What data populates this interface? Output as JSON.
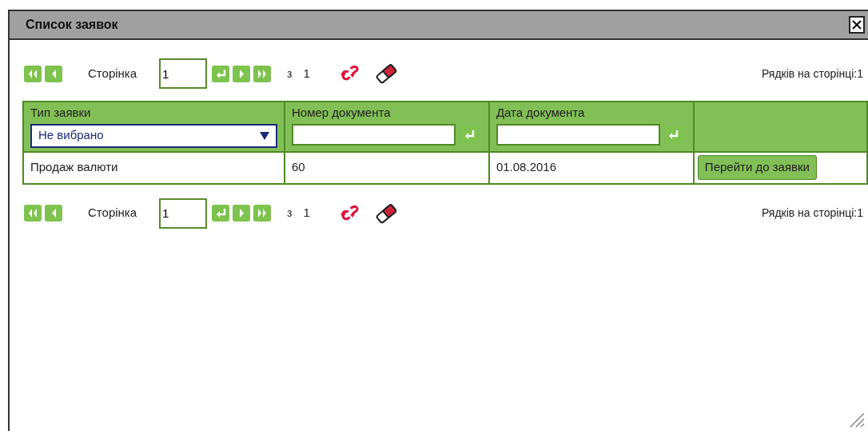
{
  "window": {
    "title": "Список заявок"
  },
  "pager_top": {
    "page_label": "Сторінка",
    "page_value": "1",
    "of_label": "з",
    "total": "1",
    "rows_per_page": "Рядків на сторінці:1"
  },
  "table": {
    "columns": [
      {
        "title": "Тип заявки",
        "filter": {
          "kind": "select",
          "value": "Не вибрано"
        }
      },
      {
        "title": "Номер документа",
        "filter": {
          "kind": "text"
        }
      },
      {
        "title": "Дата документа",
        "filter": {
          "kind": "text"
        }
      },
      {
        "filter": {
          "kind": "none"
        }
      }
    ],
    "rows": [
      {
        "cells": [
          "Продаж валюти",
          "60",
          "01.08.2016"
        ],
        "action": "Перейти до заявки"
      }
    ]
  },
  "pager_bottom": {
    "page_label": "Сторінка",
    "page_value": "1",
    "of_label": "з",
    "total": "1",
    "rows_per_page": "Рядків на сторінці:1"
  }
}
